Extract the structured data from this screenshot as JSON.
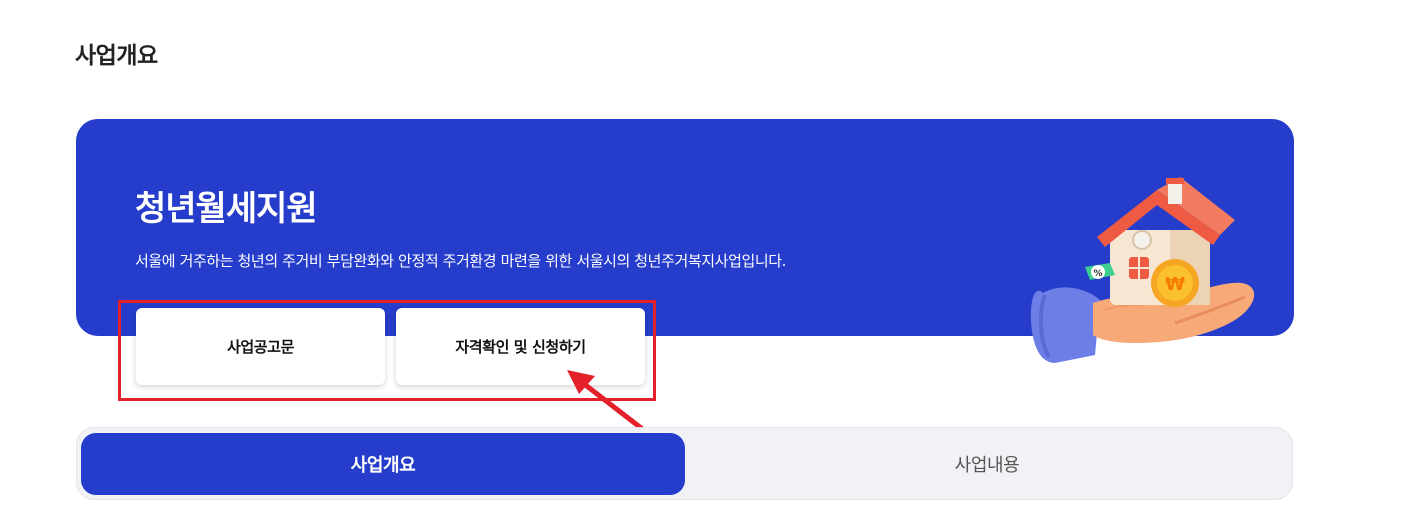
{
  "page": {
    "section_title": "사업개요"
  },
  "banner": {
    "title": "청년월세지원",
    "description": "서울에 거주하는 청년의 주거비 부담완화와 안정적 주거환경 마련을 위한 서울시의 청년주거복지사업입니다.",
    "background_color": "#253dca",
    "illustration": "house-on-hand-icon"
  },
  "buttons": {
    "notice_label": "사업공고문",
    "apply_label": "자격확인 및 신청하기"
  },
  "annotation": {
    "highlight_color": "#e4202b"
  },
  "tabs": [
    {
      "label": "사업개요",
      "active": true
    },
    {
      "label": "사업내용",
      "active": false
    }
  ]
}
